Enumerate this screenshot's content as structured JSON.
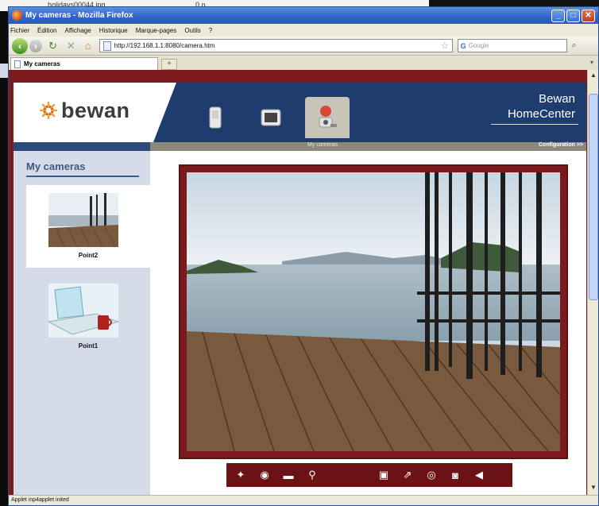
{
  "background": {
    "file_name": "holidays00044.jpg",
    "file_size": "0 o"
  },
  "window": {
    "title": "My cameras - Mozilla Firefox",
    "minimize": "_",
    "restore": "□",
    "close": "✕"
  },
  "menu": [
    "Fichier",
    "Édition",
    "Affichage",
    "Historique",
    "Marque-pages",
    "Outils",
    "?"
  ],
  "nav": {
    "url": "http://192.168.1.1:8080/camera.htm",
    "search_placeholder": "Google"
  },
  "tab": {
    "label": "My cameras",
    "new_tab": "+"
  },
  "brand": {
    "logo_text": "bewan",
    "title_line1": "Bewan",
    "title_line2": "HomeCenter"
  },
  "strip": {
    "my_cameras": "My cameras",
    "configuration": "Configuration  >>"
  },
  "sidebar": {
    "title": "My cameras",
    "cameras": [
      {
        "name": "Point2",
        "selected": true
      },
      {
        "name": "Point1",
        "selected": false
      }
    ]
  },
  "status": {
    "text": "Applet inp4applet inited"
  },
  "colors": {
    "frame": "#7a1c1e",
    "header": "#1f3c6e",
    "sidebar": "#d5dbe8",
    "accent": "#3c5a88"
  },
  "toolbar_icons": [
    "magic-wand",
    "zoom-video",
    "folder",
    "motion-person",
    "user-video",
    "export",
    "record",
    "snapshot",
    "mute"
  ]
}
